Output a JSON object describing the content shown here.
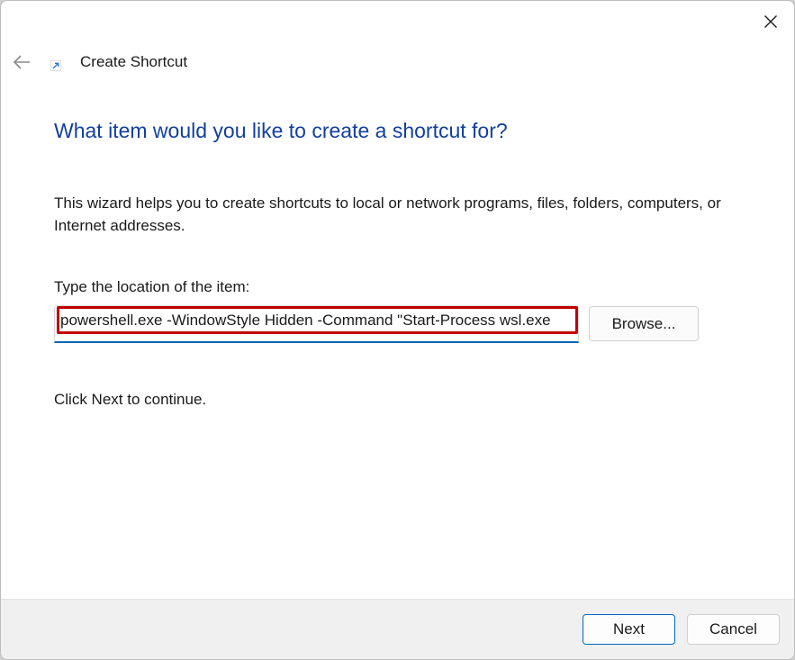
{
  "window": {
    "title": "Create Shortcut",
    "accent_color": "#0067c0",
    "highlight_color": "#c00000",
    "heading_color": "#123fa0"
  },
  "icons": {
    "close": "close-icon",
    "back": "back-arrow-icon",
    "shortcut": "shortcut-arrow-icon"
  },
  "main": {
    "heading": "What item would you like to create a shortcut for?",
    "description": "This wizard helps you to create shortcuts to local or network programs, files, folders, computers, or Internet addresses.",
    "location_label": "Type the location of the item:",
    "location_value": "powershell.exe -WindowStyle Hidden -Command \"Start-Process wsl.exe",
    "browse_label": "Browse...",
    "continue_text": "Click Next to continue."
  },
  "footer": {
    "next_label": "Next",
    "cancel_label": "Cancel"
  }
}
